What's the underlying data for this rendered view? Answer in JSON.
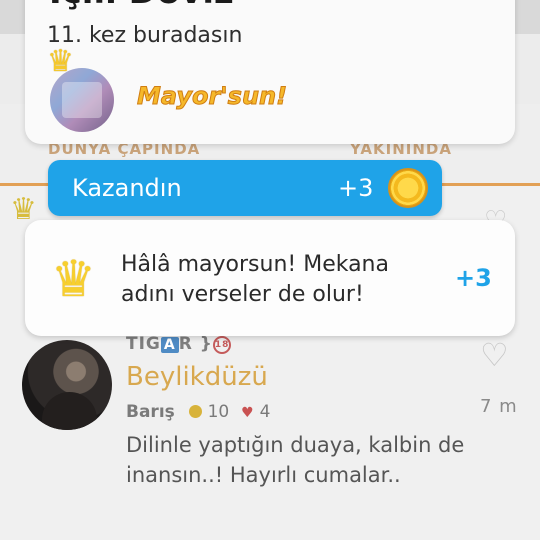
{
  "checkin": {
    "title": "İçi̇li Dövlz",
    "visit_text": "11. kez buradasın",
    "mayor_badge": "Mayor'sun!"
  },
  "tabs": {
    "worldwide": "DÜNYA ÇAPINDA",
    "nearby": "YAKININDA"
  },
  "earned": {
    "label": "Kazandın",
    "points": "+3"
  },
  "mayor_message": {
    "text": "Hâlâ mayorsun! Mekana adını verseler de olur!",
    "points": "+3"
  },
  "post": {
    "brand_prefix": "TIG",
    "brand_a": "A",
    "brand_suffix": "R }",
    "brand_badge": "18",
    "place": "Beylikdüzü",
    "user": "Barış",
    "coins": "10",
    "likes": "4",
    "time": "7 m",
    "text": "Dilinle yaptığın duaya, kalbin de inansın..! Hayırlı cumalar.."
  },
  "colors": {
    "accent_blue": "#1fa3e8",
    "mayor_gold": "#f5b82a",
    "place_gold": "#d8a84f",
    "tab_underline": "#e2a055"
  },
  "icons": {
    "crown": "crown-icon",
    "coin": "coin-icon",
    "heart": "heart-icon"
  }
}
